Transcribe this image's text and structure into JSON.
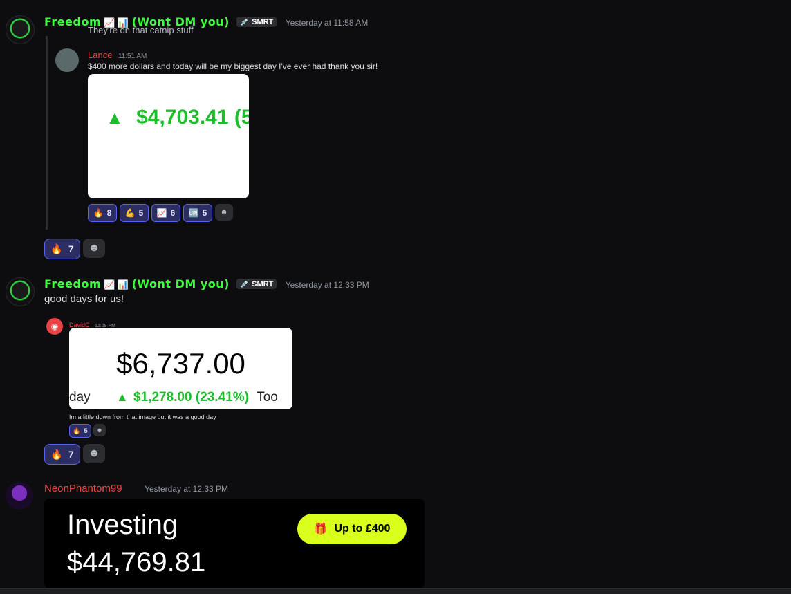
{
  "msg1": {
    "author": "Freedom",
    "author_emojis": "📈 📊",
    "author_suffix": "(Wont DM you)",
    "tag": "💉 SMRT",
    "timestamp": "Yesterday at 11:58 AM",
    "quoted_partial": "They're on that catnip stuff",
    "forward": {
      "author": "Lance",
      "timestamp": "11:51 AM",
      "text": "$400 more dollars and today will be my biggest day I've ever had  thank you sir!",
      "image_value": "$4,703.41 (5",
      "reactions": [
        {
          "emoji": "🔥",
          "count": "8"
        },
        {
          "emoji": "💪",
          "count": "5"
        },
        {
          "emoji": "📈",
          "count": "6"
        },
        {
          "emoji": "🆙",
          "count": "5"
        }
      ]
    },
    "reaction": {
      "emoji": "🔥",
      "count": "7"
    }
  },
  "msg2": {
    "author": "Freedom",
    "author_emojis": "📈 📊",
    "author_suffix": "(Wont DM you)",
    "tag": "💉 SMRT",
    "timestamp": "Yesterday at 12:33 PM",
    "text": "good days for us!",
    "forward": {
      "author": "DavidC",
      "timestamp": "12:28 PM",
      "image_total": "$6,737.00",
      "image_left": "day",
      "image_gain": "$1,278.00 (23.41%)",
      "image_right": "Too",
      "text": "Im a little down from that image but it was a good day",
      "reaction": {
        "emoji": "🔥",
        "count": "5"
      }
    },
    "reaction": {
      "emoji": "🔥",
      "count": "7"
    }
  },
  "msg3": {
    "author": "NeonPhantom99",
    "timestamp": "Yesterday at 12:33 PM",
    "card_title": "Investing",
    "card_value": "$44,769.81",
    "card_button": "Up to £400"
  },
  "colors": {
    "background": "#0d0d0f",
    "username_green": "#3dff3d",
    "username_red": "#f04747",
    "reaction_bg": "#2b2d63",
    "reaction_border": "#5865f2",
    "gain_green": "#1fbd2c",
    "cta": "#d9ff1c"
  }
}
